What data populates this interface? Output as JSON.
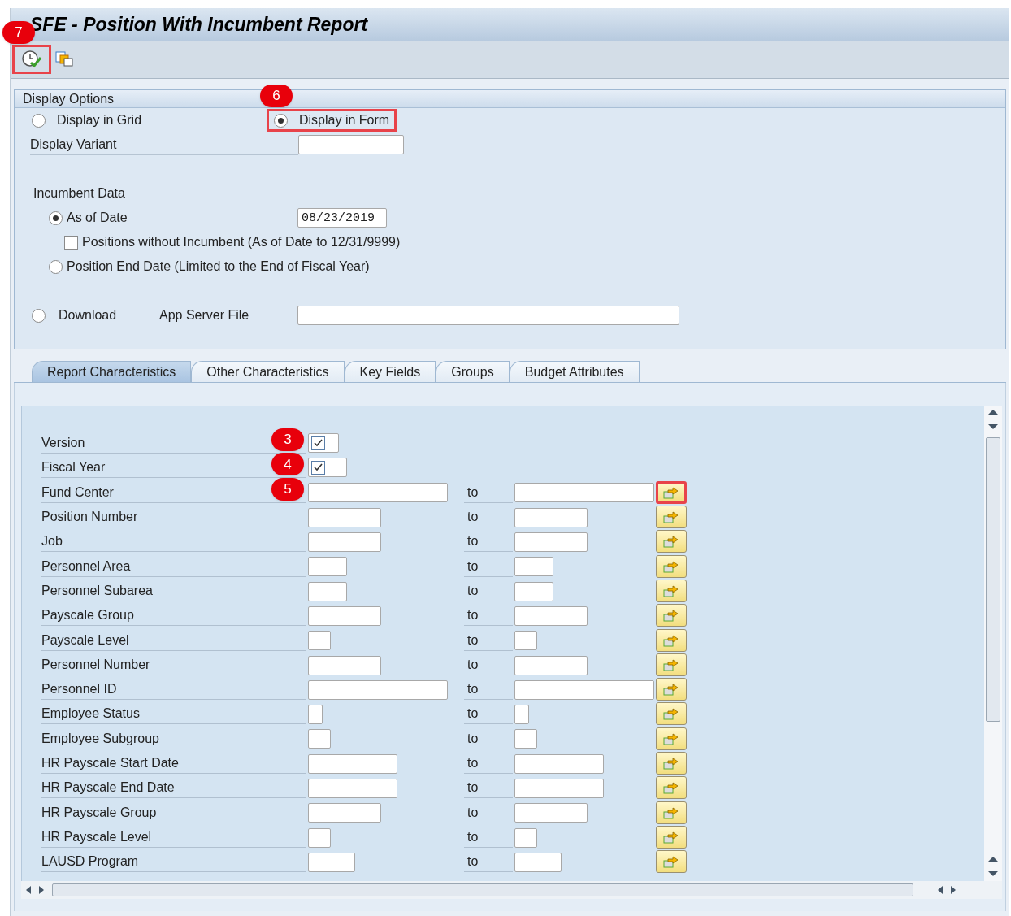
{
  "window": {
    "title": "SFE - Position With Incumbent Report"
  },
  "toolbar": {
    "execute_badge": "7",
    "execute_highlighted": true
  },
  "display_options": {
    "title": "Display Options",
    "output": [
      {
        "label": "Display in Grid",
        "selected": false,
        "highlighted": false
      },
      {
        "label": "Display in Form",
        "selected": true,
        "badge": "6",
        "highlighted": true
      }
    ],
    "variant": {
      "label": "Display Variant"
    },
    "incumbent": {
      "title": "Incumbent Data",
      "as_of": {
        "label": "As of Date",
        "selected": true,
        "value": "08/23/2019"
      },
      "without": {
        "label": "Positions without Incumbent (As of Date to 12/31/9999)",
        "checked": false
      },
      "end_date": {
        "label": "Position End Date (Limited to the End of Fiscal Year)",
        "selected": false
      }
    },
    "download": {
      "label": "Download",
      "selected": false,
      "file_label": "App Server File"
    }
  },
  "tabs": [
    {
      "label": "Report Characteristics",
      "selected": true
    },
    {
      "label": "Other Characteristics",
      "selected": false
    },
    {
      "label": "Key Fields",
      "selected": false
    },
    {
      "label": "Groups",
      "selected": false
    },
    {
      "label": "Budget Attributes",
      "selected": false
    }
  ],
  "rows": [
    {
      "kind": "checkbox",
      "label": "Version",
      "checked": true,
      "badge": "3"
    },
    {
      "kind": "checkbox",
      "label": "Fiscal Year",
      "checked": true,
      "badge": "4"
    },
    {
      "kind": "range",
      "label": "Fund Center",
      "to": "to",
      "badge": "5",
      "highlighted": true
    },
    {
      "kind": "range",
      "label": "Position Number",
      "to": "to",
      "highlighted": false
    },
    {
      "kind": "range",
      "label": "Job",
      "to": "to",
      "highlighted": false
    },
    {
      "kind": "range",
      "label": "Personnel Area",
      "to": "to",
      "highlighted": false
    },
    {
      "kind": "range",
      "label": "Personnel Subarea",
      "to": "to",
      "highlighted": false
    },
    {
      "kind": "range",
      "label": "Payscale Group",
      "to": "to",
      "highlighted": false
    },
    {
      "kind": "range",
      "label": "Payscale Level",
      "to": "to",
      "highlighted": false
    },
    {
      "kind": "range",
      "label": "Personnel Number",
      "to": "to",
      "highlighted": false
    },
    {
      "kind": "range",
      "label": "Personnel ID",
      "to": "to",
      "highlighted": false
    },
    {
      "kind": "range",
      "label": "Employee Status",
      "to": "to",
      "highlighted": false
    },
    {
      "kind": "range",
      "label": "Employee Subgroup",
      "to": "to",
      "highlighted": false
    },
    {
      "kind": "range",
      "label": "HR Payscale Start Date",
      "to": "to",
      "highlighted": false
    },
    {
      "kind": "range",
      "label": "HR Payscale End Date",
      "to": "to",
      "highlighted": false
    },
    {
      "kind": "range",
      "label": "HR Payscale Group",
      "to": "to",
      "highlighted": false
    },
    {
      "kind": "range",
      "label": "HR Payscale Level",
      "to": "to",
      "highlighted": false
    },
    {
      "kind": "range",
      "label": "LAUSD Program",
      "to": "to",
      "highlighted": false
    }
  ]
}
